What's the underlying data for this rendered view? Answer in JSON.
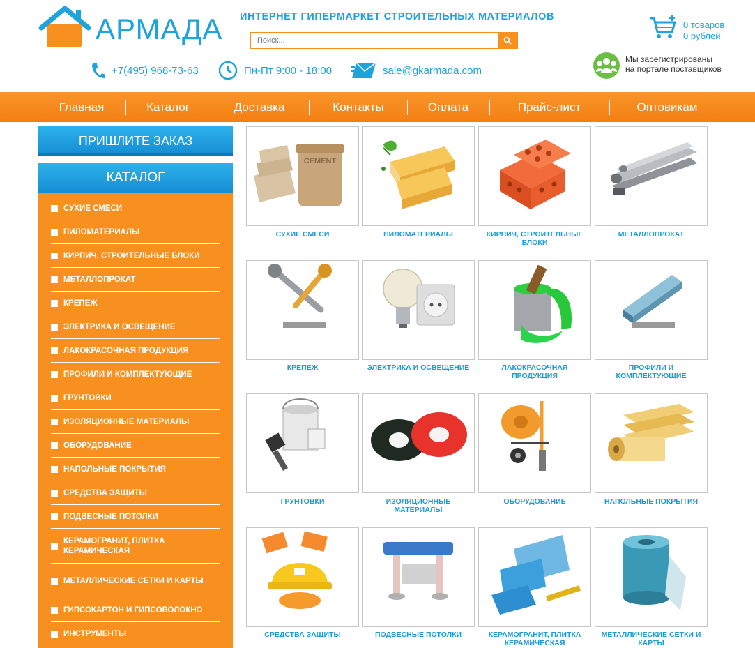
{
  "header": {
    "logo_text": "АРМАДА",
    "tagline": "ИНТЕРНЕТ ГИПЕРМАРКЕТ СТРОИТЕЛЬНЫХ МАТЕРИАЛОВ",
    "search_placeholder": "Поиск...",
    "cart_items": "0 товаров",
    "cart_sum": "0 рублей",
    "phone": "+7(495) 968-73-63",
    "hours": "Пн-Пт 9:00 - 18:00",
    "email": "sale@gkarmada.com",
    "registered_line1": "Мы зарегистрированы",
    "registered_line2": "на портале поставщиков"
  },
  "nav": [
    "Главная",
    "Каталог",
    "Доставка",
    "Контакты",
    "Оплата",
    "Прайс-лист",
    "Оптовикам"
  ],
  "sidebar": {
    "order_button": "ПРИШЛИТЕ ЗАКАЗ",
    "catalog_title": "КАТАЛОГ",
    "items": [
      "СУХИЕ СМЕСИ",
      "ПИЛОМАТЕРИАЛЫ",
      "КИРПИЧ, СТРОИТЕЛЬНЫЕ БЛОКИ",
      "МЕТАЛЛОПРОКАТ",
      "КРЕПЕЖ",
      "ЭЛЕКТРИКА И ОСВЕЩЕНИЕ",
      "ЛАКОКРАСОЧНАЯ ПРОДУКЦИЯ",
      "ПРОФИЛИ И КОМПЛЕКТУЮЩИЕ",
      "ГРУНТОВКИ",
      "ИЗОЛЯЦИОННЫЕ МАТЕРИАЛЫ",
      "ОБОРУДОВАНИЕ",
      "НАПОЛЬНЫЕ ПОКРЫТИЯ",
      "СРЕДСТВА ЗАЩИТЫ",
      "ПОДВЕСНЫЕ ПОТОЛКИ",
      "КЕРАМОГРАНИТ, ПЛИТКА КЕРАМИЧЕСКАЯ",
      "МЕТАЛЛИЧЕСКИЕ СЕТКИ И КАРТЫ",
      "ГИПСОКАРТОН И ГИПСОВОЛОКНО",
      "ИНСТРУМЕНТЫ"
    ]
  },
  "tiles": [
    {
      "label": "СУХИЕ СМЕСИ",
      "icon": "cement-bags-icon",
      "image_text": "CEMENT"
    },
    {
      "label": "ПИЛОМАТЕРИАЛЫ",
      "icon": "lumber-icon"
    },
    {
      "label": "КИРПИЧ, СТРОИТЕЛЬНЫЕ БЛОКИ",
      "icon": "bricks-icon"
    },
    {
      "label": "МЕТАЛЛОПРОКАТ",
      "icon": "metal-pipes-icon"
    },
    {
      "label": "КРЕПЕЖ",
      "icon": "screw-icon"
    },
    {
      "label": "ЭЛЕКТРИКА И ОСВЕЩЕНИЕ",
      "icon": "lightbulb-socket-icon"
    },
    {
      "label": "ЛАКОКРАСОЧНАЯ ПРОДУКЦИЯ",
      "icon": "paint-bucket-icon"
    },
    {
      "label": "ПРОФИЛИ И КОМПЛЕКТУЮЩИЕ",
      "icon": "metal-profile-icon"
    },
    {
      "label": "ГРУНТОВКИ",
      "icon": "primer-bucket-icon"
    },
    {
      "label": "ИЗОЛЯЦИОННЫЕ МАТЕРИАЛЫ",
      "icon": "insulation-tape-icon"
    },
    {
      "label": "ОБОРУДОВАНИЕ",
      "icon": "concrete-mixer-icon"
    },
    {
      "label": "НАПОЛЬНЫЕ ПОКРЫТИЯ",
      "icon": "floor-roll-icon"
    },
    {
      "label": "СРЕДСТВА ЗАЩИТЫ",
      "icon": "hard-hat-icon"
    },
    {
      "label": "ПОДВЕСНЫЕ ПОТОЛКИ",
      "icon": "ceiling-hangers-icon"
    },
    {
      "label": "КЕРАМОГРАНИТ, ПЛИТКА КЕРАМИЧЕСКАЯ",
      "icon": "tiles-icon"
    },
    {
      "label": "МЕТАЛЛИЧЕСКИЕ СЕТКИ И КАРТЫ",
      "icon": "mesh-roll-icon"
    }
  ],
  "colors": {
    "accent_blue": "#1fa3de",
    "accent_orange": "#f7901e"
  }
}
